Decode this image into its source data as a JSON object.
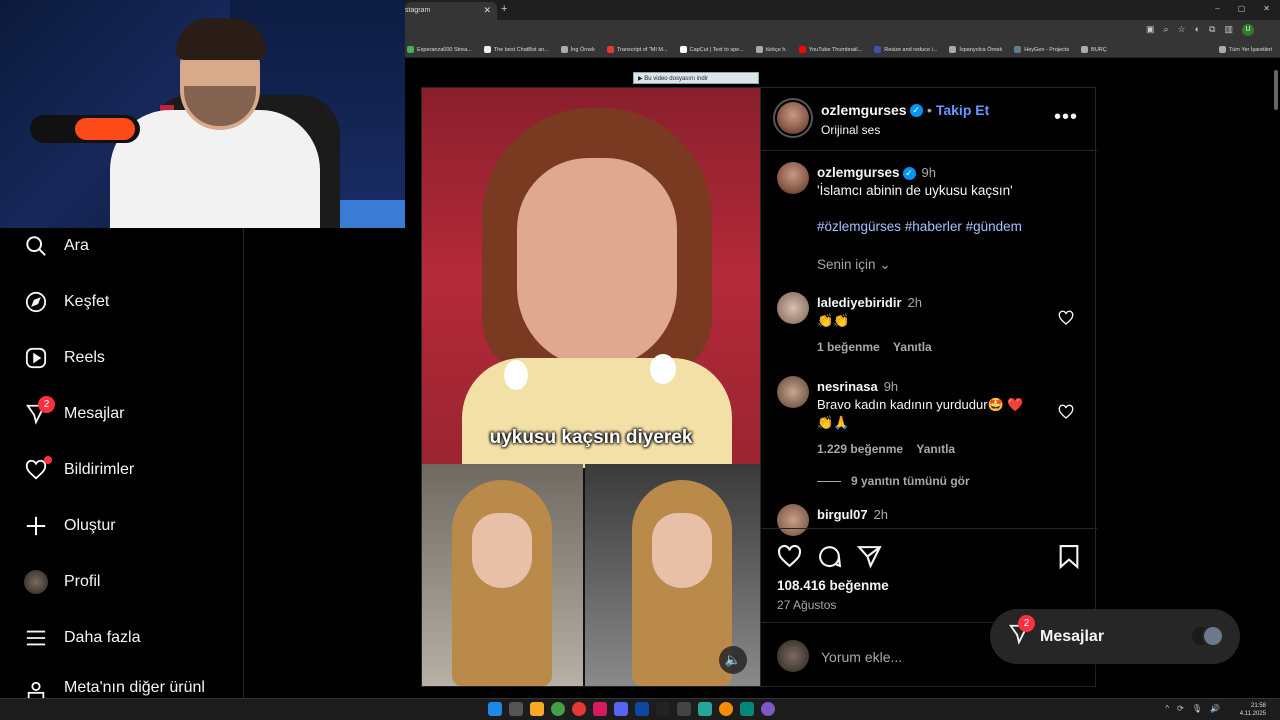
{
  "browser": {
    "tab_title": "stagram",
    "window_controls": [
      "–",
      "▢",
      "✕"
    ],
    "toolbar_icons": [
      "▣",
      "⌕",
      "☆",
      "◐",
      "⧉",
      "▥",
      "U",
      "⋮"
    ],
    "bookmarks": [
      "Esperanza000 Strea...",
      "The best ChatBot an...",
      "İng Örnek",
      "Transcript of \"MI M...",
      "CapCut | Text to spe...",
      "türkçe h.",
      "YouTube Thumbnail...",
      "Resize and reduce i...",
      "İspanyolca Örnek",
      "HeyGen - Projects",
      "BURÇ"
    ],
    "bookmarks_all": "Tüm Yer İşaretleri",
    "download_bar": "Bu video dosyasını indir"
  },
  "sidebar": {
    "items": [
      {
        "label": "Ara",
        "icon": "search-icon"
      },
      {
        "label": "Keşfet",
        "icon": "compass-icon"
      },
      {
        "label": "Reels",
        "icon": "reels-icon"
      },
      {
        "label": "Mesajlar",
        "icon": "messenger-icon",
        "badge": "2"
      },
      {
        "label": "Bildirimler",
        "icon": "heart-icon",
        "dot": true
      },
      {
        "label": "Oluştur",
        "icon": "plus-icon"
      },
      {
        "label": "Profil",
        "icon": "avatar"
      },
      {
        "label": "Daha fazla",
        "icon": "menu-icon"
      },
      {
        "label": "Meta'nın diğer ürünl",
        "icon": "meta-icon"
      }
    ]
  },
  "post": {
    "author": "ozlemgurses",
    "follow_label": "Takip Et",
    "audio": "Orijinal ses",
    "video_caption": "uykusu kaçsın diyerek",
    "caption": {
      "user": "ozlemgurses",
      "time": "9h",
      "text": "'İslamcı abinin de uykusu kaçsın'",
      "hashtags": "#özlemgürses #haberler #gündem"
    },
    "for_you": "Senin için",
    "comments": [
      {
        "user": "lalediyebiridir",
        "time": "2h",
        "text": "👏👏",
        "likes": "1 beğenme",
        "reply": "Yanıtla"
      },
      {
        "user": "nesrinasa",
        "time": "9h",
        "text": "Bravo kadın kadının yurdudur🤩 ❤️",
        "text2": "👏🙏",
        "likes": "1.229 beğenme",
        "reply": "Yanıtla",
        "view_replies": "9 yanıtın tümünü gör"
      },
      {
        "user": "birgul07",
        "time": "2h"
      }
    ],
    "likes_count": "108.416 beğenme",
    "date": "27 Ağustos",
    "comment_placeholder": "Yorum ekle..."
  },
  "messages_pill": {
    "label": "Mesajlar",
    "badge": "2"
  },
  "taskbar": {
    "time": "21:58",
    "date": "4.11.2025"
  },
  "colors": {
    "accent_blue": "#0095f6",
    "badge_red": "#ff3040",
    "follow_blue": "#6a97ff"
  }
}
